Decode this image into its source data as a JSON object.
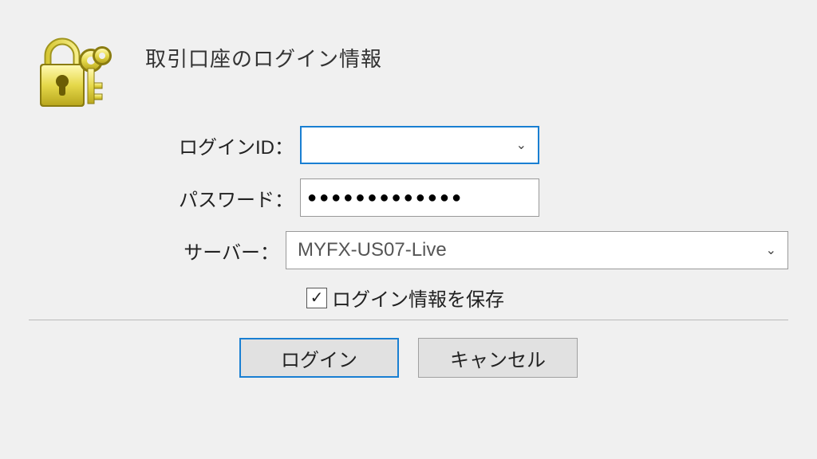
{
  "title": "取引口座のログイン情報",
  "labels": {
    "login_id": "ログインID：",
    "password": "パスワード：",
    "server": "サーバー："
  },
  "fields": {
    "login_id_value": "",
    "password_masked": "●●●●●●●●●●●●●",
    "server_value": "MYFX-US07-Live"
  },
  "checkbox": {
    "checked_mark": "✓",
    "label": "ログイン情報を保存"
  },
  "buttons": {
    "login": "ログイン",
    "cancel": "キャンセル"
  }
}
